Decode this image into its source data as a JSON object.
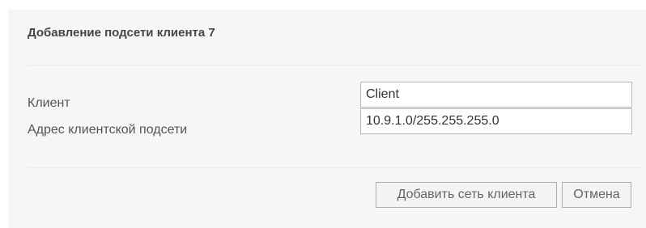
{
  "dialog": {
    "title": "Добавление подсети клиента 7"
  },
  "form": {
    "client": {
      "label": "Клиент",
      "value": "Client"
    },
    "subnet": {
      "label": "Адрес клиентской подсети",
      "value": "10.9.1.0/255.255.255.0"
    }
  },
  "actions": {
    "add_label": "Добавить сеть клиента",
    "cancel_label": "Отмена"
  }
}
